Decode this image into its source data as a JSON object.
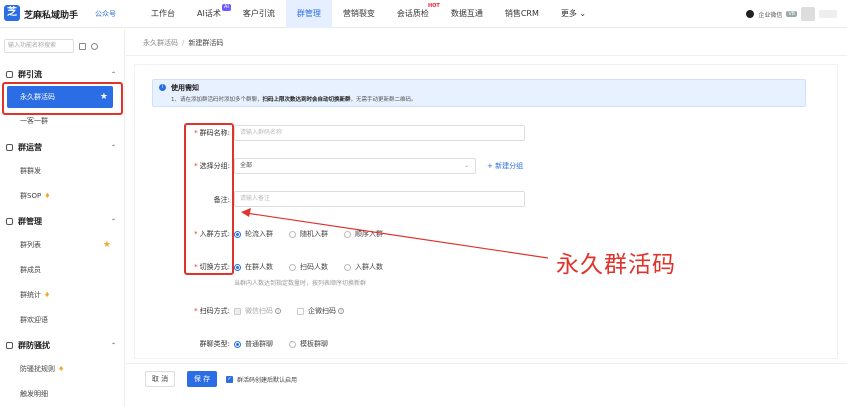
{
  "header": {
    "logo_glyph": "芝",
    "app_title": "芝麻私域助手",
    "account_type": "公众号",
    "nav": [
      {
        "label": "工作台",
        "badge": ""
      },
      {
        "label": "AI话术",
        "badge": "AI"
      },
      {
        "label": "客户引流",
        "badge": ""
      },
      {
        "label": "群管理",
        "badge": ""
      },
      {
        "label": "营销裂变",
        "badge": ""
      },
      {
        "label": "会话质检",
        "badge": "HOT"
      },
      {
        "label": "数据互通",
        "badge": ""
      },
      {
        "label": "销售CRM",
        "badge": ""
      },
      {
        "label": "更多 ⌄",
        "badge": ""
      }
    ],
    "active_nav": "群管理",
    "right": {
      "corp_label": "企业微信",
      "badge": "V8"
    }
  },
  "sidebar": {
    "search_placeholder": "输入功能名称搜索",
    "groups": [
      {
        "title": "群引流",
        "items": [
          {
            "label": "永久群活码",
            "starred": true,
            "active": true
          },
          {
            "label": "一客一群"
          }
        ]
      },
      {
        "title": "群运营",
        "items": [
          {
            "label": "群群发"
          },
          {
            "label": "群SOP",
            "gem": true
          }
        ]
      },
      {
        "title": "群管理",
        "items": [
          {
            "label": "群列表",
            "starred": true
          },
          {
            "label": "群成员"
          },
          {
            "label": "群统计",
            "gem": true
          },
          {
            "label": "群欢迎语"
          }
        ]
      },
      {
        "title": "群防骚扰",
        "items": [
          {
            "label": "防骚扰规则",
            "gem": true
          },
          {
            "label": "触发明细"
          }
        ]
      }
    ]
  },
  "breadcrumb": {
    "parent": "永久群活码",
    "separator": "/",
    "current": "新建群活码"
  },
  "notice": {
    "icon": "i",
    "title": "使用需知",
    "text_pre": "1、请在添加群活码时添加多个群聊，",
    "text_bold": "扫码上限次数达到时会自动切换新群",
    "text_post": "，无需手动更新群二维码。"
  },
  "form": {
    "name_label": "群码名称:",
    "name_placeholder": "请输入群码名称",
    "group_label": "选择分组:",
    "group_value": "全部",
    "new_group": "+ 新建分组",
    "remark_label": "备注:",
    "remark_placeholder": "请输入备注",
    "join_label": "入群方式:",
    "join_options": [
      "轮流入群",
      "随机入群",
      "顺序入群"
    ],
    "switch_label": "切换方式:",
    "switch_options": [
      "在群人数",
      "扫码人数",
      "入群人数"
    ],
    "switch_hint": "当群内人数达到指定数量时，按列表顺序切换新群",
    "scan_label": "扫码方式:",
    "scan_options": [
      "微信扫码",
      "企微扫码"
    ],
    "chat_type_label": "群聊类型:",
    "chat_type_options": [
      "普通群聊",
      "模板群聊"
    ]
  },
  "annotation": {
    "text": "永久群活码"
  },
  "footer": {
    "cancel": "取 消",
    "save": "保 存",
    "enable_label": "群活码创建后默认启用"
  },
  "colors": {
    "primary": "#2b6de5",
    "annotation_red": "#e0332b",
    "star": "#f5a623"
  }
}
